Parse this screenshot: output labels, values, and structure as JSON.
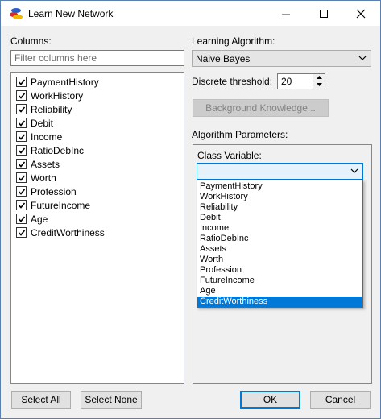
{
  "window": {
    "title": "Learn New Network",
    "app_icon": "network-app-icon"
  },
  "columns": {
    "label": "Columns:",
    "filter_placeholder": "Filter columns here",
    "items": [
      {
        "label": "PaymentHistory",
        "checked": true
      },
      {
        "label": "WorkHistory",
        "checked": true
      },
      {
        "label": "Reliability",
        "checked": true
      },
      {
        "label": "Debit",
        "checked": true
      },
      {
        "label": "Income",
        "checked": true
      },
      {
        "label": "RatioDebInc",
        "checked": true
      },
      {
        "label": "Assets",
        "checked": true
      },
      {
        "label": "Worth",
        "checked": true
      },
      {
        "label": "Profession",
        "checked": true
      },
      {
        "label": "FutureIncome",
        "checked": true
      },
      {
        "label": "Age",
        "checked": true
      },
      {
        "label": "CreditWorthiness",
        "checked": true
      }
    ]
  },
  "algorithm": {
    "label": "Learning Algorithm:",
    "selected": "Naive Bayes"
  },
  "threshold": {
    "label": "Discrete threshold:",
    "value": "20"
  },
  "background_knowledge_label": "Background Knowledge...",
  "params": {
    "label": "Algorithm Parameters:",
    "class_variable_label": "Class Variable:",
    "class_variable_value": "",
    "options": [
      "PaymentHistory",
      "WorkHistory",
      "Reliability",
      "Debit",
      "Income",
      "RatioDebInc",
      "Assets",
      "Worth",
      "Profession",
      "FutureIncome",
      "Age",
      "CreditWorthiness"
    ],
    "highlighted": "CreditWorthiness"
  },
  "buttons": {
    "select_all": "Select All",
    "select_none": "Select None",
    "ok": "OK",
    "cancel": "Cancel"
  },
  "colors": {
    "accent": "#0078d7",
    "disabled_text": "#838383"
  }
}
